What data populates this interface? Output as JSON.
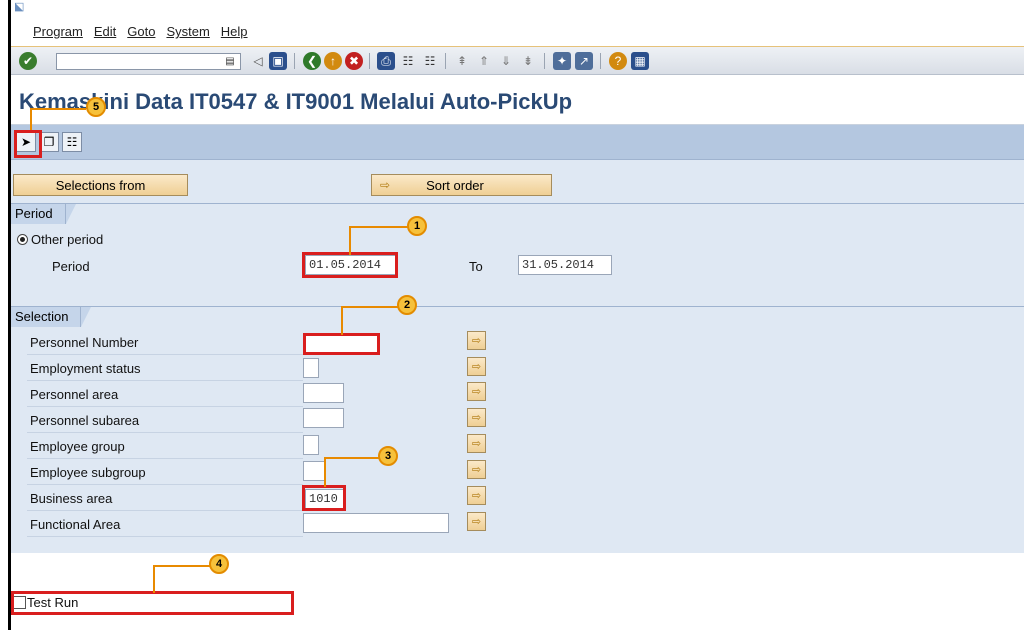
{
  "menu": [
    "Program",
    "Edit",
    "Goto",
    "System",
    "Help"
  ],
  "title": "Kemaskini Data IT0547 & IT9001 Melalui Auto-PickUp",
  "buttons": {
    "selections_from": "Selections from",
    "sort_order": "Sort order"
  },
  "period": {
    "group_label": "Period",
    "radio_label": "Other period",
    "period_label": "Period",
    "from": "01.05.2014",
    "to_label": "To",
    "to": "31.05.2014"
  },
  "selection": {
    "group_label": "Selection",
    "rows": [
      {
        "label": "Personnel Number",
        "value": ""
      },
      {
        "label": "Employment status",
        "value": ""
      },
      {
        "label": "Personnel area",
        "value": ""
      },
      {
        "label": "Personnel subarea",
        "value": ""
      },
      {
        "label": "Employee group",
        "value": ""
      },
      {
        "label": "Employee subgroup",
        "value": ""
      },
      {
        "label": "Business area",
        "value": "1010"
      },
      {
        "label": "Functional Area",
        "value": ""
      }
    ]
  },
  "test_run_label": "Test Run",
  "callouts": [
    "1",
    "2",
    "3",
    "4",
    "5"
  ],
  "colors": {
    "accent_red": "#d91e1e",
    "callout_orange": "#f6c13b",
    "title_blue": "#2a4a75"
  },
  "icons": {
    "ok": "check-icon",
    "save": "save-icon",
    "back": "back-icon",
    "exit": "exit-icon",
    "cancel": "cancel-icon",
    "print": "print-icon",
    "find": "find-icon",
    "help": "help-icon",
    "execute": "execute-icon",
    "variants": "variants-icon",
    "selection_options": "selection-options-icon"
  }
}
